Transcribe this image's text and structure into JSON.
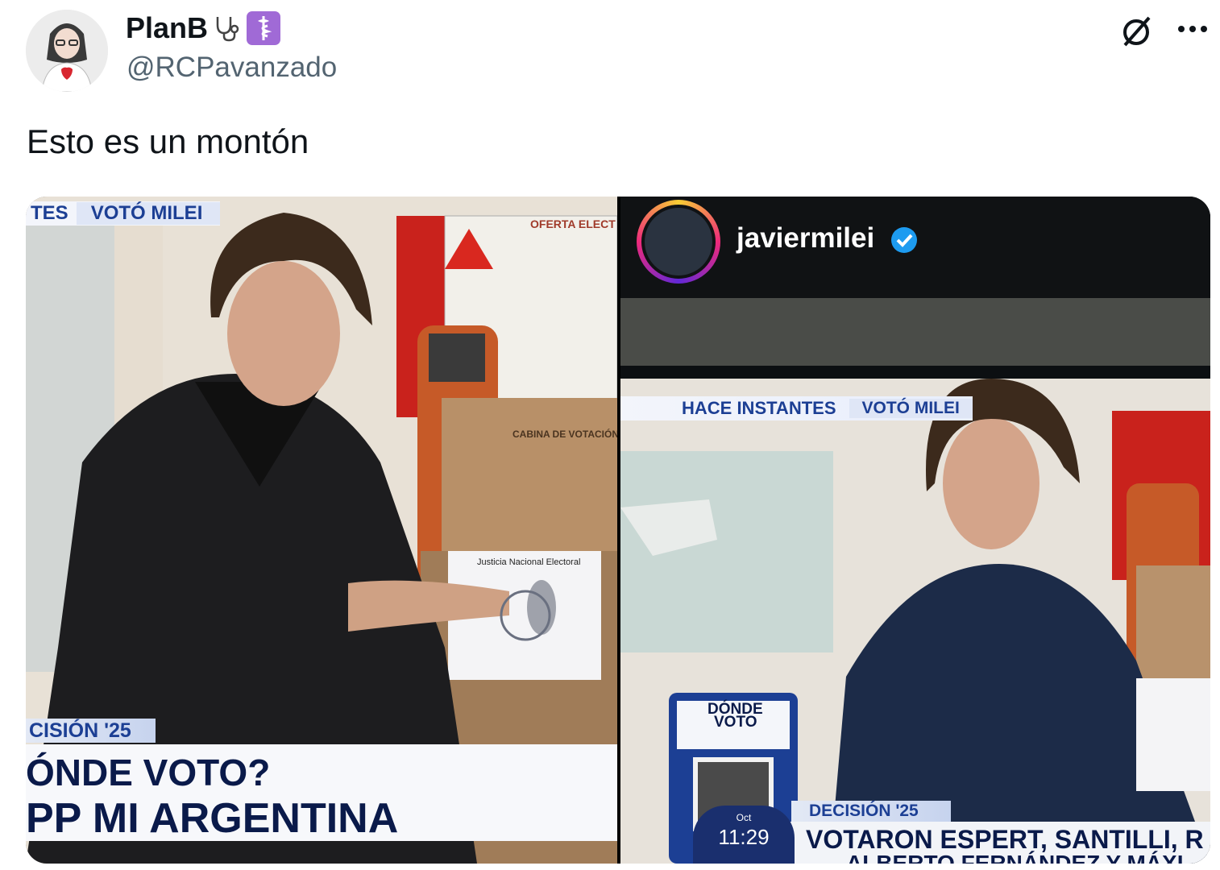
{
  "tweet": {
    "display_name": "PlanB",
    "handle": "@RCPavanzado",
    "text": "Esto es un montón",
    "badges": [
      "stethoscope-emoji",
      "medical-symbol-emoji"
    ]
  },
  "header_actions": {
    "grok_icon": "grok-icon",
    "more_icon": "more-icon"
  },
  "left_image": {
    "tag_left": "TES",
    "tag_right": "VOTÓ MILEI",
    "sign_text": "OFERTA ELECT",
    "booth_text": "CABINA DE VOTACIÓN",
    "ballot_header": "Justicia Nacional Electoral",
    "decision": "CISIÓN '25",
    "headline1": "ÓNDE VOTO?",
    "headline2": "PP MI ARGENTINA"
  },
  "right_image": {
    "account": "javiermilei",
    "tag_left": "HACE INSTANTES",
    "tag_right": "VOTÓ MILEI",
    "qr_label1": "DÓNDE",
    "qr_label2": "VOTO",
    "decision": "DECISIÓN '25",
    "clock_label": "Oct",
    "clock_time": "11:29",
    "ticker1": "VOTARON ESPERT, SANTILLI, R",
    "ticker2": "ALBERTO FERNÁNDEZ Y MÁXI"
  },
  "colors": {
    "accent_purple": "#a06ad6",
    "verified_blue": "#1d9bf0",
    "tv_blue": "#1c3f94",
    "tv_navy": "#0a1a4a"
  }
}
